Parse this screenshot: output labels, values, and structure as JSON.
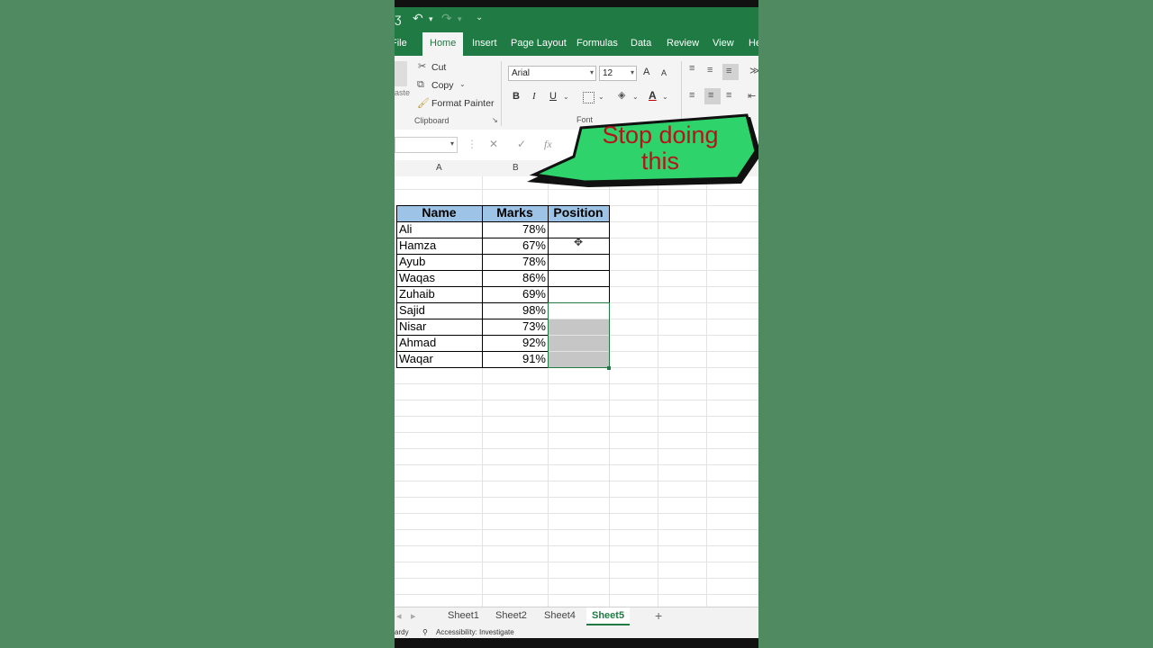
{
  "qat": {
    "save_glyph": "ʒ",
    "undo_glyph": "↶",
    "redo_glyph": "↷",
    "more_glyph": "⌄"
  },
  "ribbon_tabs": [
    "File",
    "Home",
    "Insert",
    "Page Layout",
    "Formulas",
    "Data",
    "Review",
    "View",
    "He"
  ],
  "active_tab": "Home",
  "clipboard": {
    "paste_label": "aste",
    "cut_label": "Cut",
    "copy_label": "Copy",
    "format_painter_label": "Format Painter",
    "group_label": "Clipboard"
  },
  "font": {
    "name": "Arial",
    "size": "12",
    "bold": "B",
    "italic": "I",
    "underline": "U",
    "grow": "A",
    "shrink": "A",
    "group_label": "Font"
  },
  "formula_bar": {
    "fx": "fx",
    "cancel": "✕",
    "enter": "✓"
  },
  "columns": [
    "A",
    "B"
  ],
  "table": {
    "headers": [
      "Name",
      "Marks",
      "Position"
    ],
    "rows": [
      {
        "name": "Ali",
        "marks": "78%"
      },
      {
        "name": "Hamza",
        "marks": "67%"
      },
      {
        "name": "Ayub",
        "marks": "78%"
      },
      {
        "name": "Waqas",
        "marks": "86%"
      },
      {
        "name": "Zuhaib",
        "marks": "69%"
      },
      {
        "name": "Sajid",
        "marks": "98%"
      },
      {
        "name": "Nisar",
        "marks": "73%"
      },
      {
        "name": "Ahmad",
        "marks": "92%"
      },
      {
        "name": "Waqar",
        "marks": "91%"
      }
    ]
  },
  "callout": {
    "line1": "Stop doing",
    "line2": "this"
  },
  "sheets": [
    "Sheet1",
    "Sheet2",
    "Sheet4",
    "Sheet5"
  ],
  "active_sheet": "Sheet5",
  "add_sheet": "+",
  "status": {
    "left": "ardy",
    "accessibility": "Accessibility: Investigate"
  },
  "colors": {
    "excel_green": "#1f7a43",
    "header_fill": "#9dc3e6",
    "callout_fill": "#2ed46b",
    "callout_text": "#b3161a",
    "background": "#4f8a60"
  }
}
